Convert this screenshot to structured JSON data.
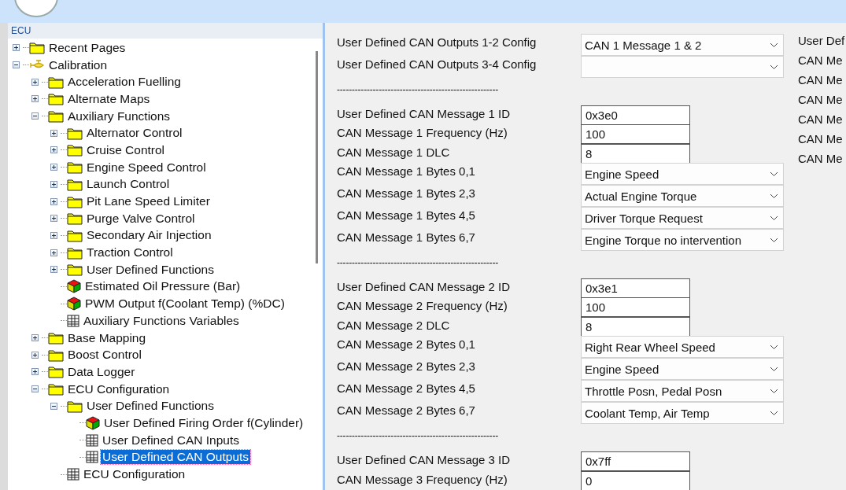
{
  "tree_panel": {
    "title": "ECU",
    "items": [
      {
        "label": "Recent Pages",
        "kind": "folder",
        "expanded": false,
        "selected": false
      },
      {
        "label": "Calibration",
        "kind": "valve",
        "expanded": true,
        "selected": false,
        "children": [
          {
            "label": "Acceleration Fuelling",
            "kind": "folder",
            "expanded": false,
            "selected": false
          },
          {
            "label": "Alternate Maps",
            "kind": "folder",
            "expanded": false,
            "selected": false
          },
          {
            "label": "Auxiliary Functions",
            "kind": "folder",
            "expanded": true,
            "selected": false,
            "children": [
              {
                "label": "Alternator Control",
                "kind": "folder",
                "expanded": false,
                "selected": false
              },
              {
                "label": "Cruise Control",
                "kind": "folder",
                "expanded": false,
                "selected": false
              },
              {
                "label": "Engine Speed Control",
                "kind": "folder",
                "expanded": false,
                "selected": false
              },
              {
                "label": "Launch Control",
                "kind": "folder",
                "expanded": false,
                "selected": false
              },
              {
                "label": "Pit Lane Speed Limiter",
                "kind": "folder",
                "expanded": false,
                "selected": false
              },
              {
                "label": "Purge Valve Control",
                "kind": "folder",
                "expanded": false,
                "selected": false
              },
              {
                "label": "Secondary Air Injection",
                "kind": "folder",
                "expanded": false,
                "selected": false
              },
              {
                "label": "Traction Control",
                "kind": "folder",
                "expanded": false,
                "selected": false
              },
              {
                "label": "User Defined Functions",
                "kind": "folder",
                "expanded": false,
                "selected": false
              },
              {
                "label": "Estimated Oil Pressure (Bar)",
                "kind": "cube",
                "selected": false
              },
              {
                "label": "PWM Output f(Coolant Temp) (%DC)",
                "kind": "cube",
                "selected": false
              },
              {
                "label": "Auxiliary Functions Variables",
                "kind": "table",
                "selected": false
              }
            ]
          },
          {
            "label": "Base Mapping",
            "kind": "folder",
            "expanded": false,
            "selected": false
          },
          {
            "label": "Boost Control",
            "kind": "folder",
            "expanded": false,
            "selected": false
          },
          {
            "label": "Data Logger",
            "kind": "folder",
            "expanded": false,
            "selected": false
          },
          {
            "label": "ECU Configuration",
            "kind": "folder",
            "expanded": true,
            "selected": false,
            "children": [
              {
                "label": "User Defined Functions",
                "kind": "folder",
                "expanded": true,
                "selected": false,
                "children": [
                  {
                    "label": "User Defined Firing Order f(Cylinder)",
                    "kind": "cube",
                    "selected": false
                  },
                  {
                    "label": "User Defined CAN Inputs",
                    "kind": "table",
                    "selected": false
                  },
                  {
                    "label": "User Defined CAN Outputs",
                    "kind": "table",
                    "selected": true
                  }
                ]
              },
              {
                "label": "ECU Configuration",
                "kind": "table",
                "selected": false
              }
            ]
          }
        ]
      }
    ]
  },
  "form": {
    "rows": [
      {
        "kind": "select",
        "label": "User Defined CAN Outputs 1-2 Config",
        "value": "CAN 1 Message 1 & 2"
      },
      {
        "kind": "select",
        "label": "User Defined CAN Outputs 3-4 Config"
      },
      {
        "kind": "separator",
        "text": "------------------------------------------------------"
      },
      {
        "kind": "input",
        "label": "User Defined CAN Message 1 ID",
        "value": "0x3e0"
      },
      {
        "kind": "input",
        "label": "CAN Message 1 Frequency (Hz)",
        "value": "100"
      },
      {
        "kind": "input",
        "label": "CAN Message 1 DLC",
        "value": "8"
      },
      {
        "kind": "select",
        "label": "CAN Message 1 Bytes 0,1",
        "value": "Engine Speed"
      },
      {
        "kind": "select",
        "label": "CAN Message 1 Bytes 2,3",
        "value": "Actual Engine Torque"
      },
      {
        "kind": "select",
        "label": "CAN Message 1 Bytes 4,5",
        "value": "Driver Torque Request"
      },
      {
        "kind": "select",
        "label": "CAN Message 1 Bytes 6,7",
        "value": "Engine Torque no intervention"
      },
      {
        "kind": "separator",
        "text": "------------------------------------------------------"
      },
      {
        "kind": "input",
        "label": "User Defined CAN Message 2 ID",
        "value": "0x3e1"
      },
      {
        "kind": "input",
        "label": "CAN Message 2 Frequency (Hz)",
        "value": "100"
      },
      {
        "kind": "input",
        "label": "CAN Message 2 DLC",
        "value": "8"
      },
      {
        "kind": "select",
        "label": "CAN Message 2 Bytes 0,1",
        "value": "Right Rear Wheel Speed"
      },
      {
        "kind": "select",
        "label": "CAN Message 2 Bytes 2,3",
        "value": "Engine Speed"
      },
      {
        "kind": "select",
        "label": "CAN Message 2 Bytes 4,5",
        "value": "Throttle Posn, Pedal Posn"
      },
      {
        "kind": "select",
        "label": "CAN Message 2 Bytes 6,7",
        "value": "Coolant Temp, Air Temp"
      },
      {
        "kind": "separator",
        "text": "------------------------------------------------------"
      },
      {
        "kind": "input",
        "label": "User Defined CAN Message 3 ID",
        "value": "0x7ff"
      },
      {
        "kind": "input",
        "label": "CAN Message 3 Frequency (Hz)",
        "value": "0"
      }
    ]
  },
  "side_column": {
    "items": [
      "User Def",
      "CAN Me",
      "CAN Me",
      "CAN Me",
      "CAN Me",
      "CAN Me",
      "CAN Me"
    ]
  }
}
